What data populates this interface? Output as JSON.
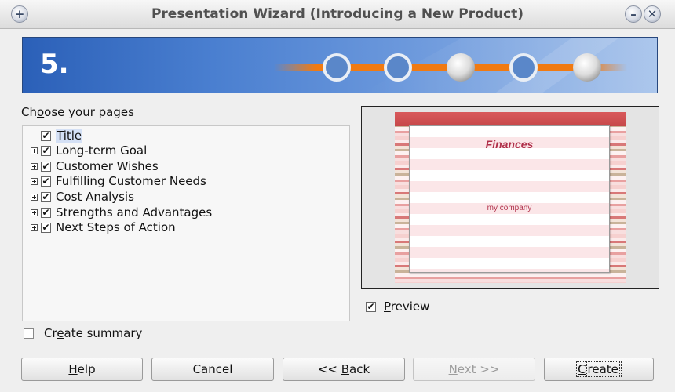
{
  "window": {
    "title": "Presentation Wizard (Introducing a New Product)",
    "menu_icon": "plus-icon",
    "minimize_icon": "minimize-icon",
    "close_icon": "close-icon"
  },
  "banner": {
    "step_number": "5.",
    "colors": {
      "banner_blue": "#2b60b8",
      "track_orange": "#f07a12"
    }
  },
  "pages": {
    "label_prefix": "Ch",
    "label_mnemonic": "o",
    "label_suffix": "ose your pages",
    "items": [
      {
        "label": "Title",
        "checked": true,
        "expandable": false,
        "selected": true
      },
      {
        "label": "Long-term Goal",
        "checked": true,
        "expandable": true,
        "selected": false
      },
      {
        "label": "Customer Wishes",
        "checked": true,
        "expandable": true,
        "selected": false
      },
      {
        "label": "Fulfilling Customer Needs",
        "checked": true,
        "expandable": true,
        "selected": false
      },
      {
        "label": "Cost Analysis",
        "checked": true,
        "expandable": true,
        "selected": false
      },
      {
        "label": "Strengths and Advantages",
        "checked": true,
        "expandable": true,
        "selected": false
      },
      {
        "label": "Next Steps of Action",
        "checked": true,
        "expandable": true,
        "selected": false
      }
    ]
  },
  "preview": {
    "slide_title": "Finances",
    "slide_company": "my company",
    "checkbox_mnemonic": "P",
    "checkbox_rest": "review",
    "checked": true
  },
  "summary": {
    "mnemonic_before": "Cr",
    "mnemonic": "e",
    "after": "ate summary",
    "checked": false
  },
  "buttons": {
    "help_m": "H",
    "help_rest": "elp",
    "cancel": "Cancel",
    "back_pre": "<< ",
    "back_m": "B",
    "back_rest": "ack",
    "next_m": "N",
    "next_rest": "ext >>",
    "create_m": "C",
    "create_rest": "reate"
  },
  "check_mark": "✔"
}
